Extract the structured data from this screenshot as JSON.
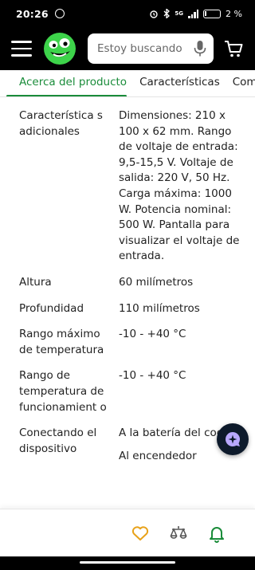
{
  "status_bar": {
    "time": "20:26",
    "network": "5G",
    "battery": "2 %"
  },
  "header": {
    "search": {
      "placeholder": "Estoy buscando"
    },
    "icons": [
      "menu-icon",
      "logo-icon",
      "mic-icon",
      "cart-icon"
    ],
    "brand_color": "#3dd34a"
  },
  "tabs": [
    {
      "label": "Acerca del producto",
      "active": true
    },
    {
      "label": "Características",
      "active": false
    },
    {
      "label": "Com",
      "active": false
    }
  ],
  "specs": [
    {
      "label": "Característica s adicionales",
      "value": "Dimensiones: 210 x 100 x 62 mm. Rango de voltaje de entrada: 9,5-15,5 V. Voltaje de salida: 220 V, 50 Hz. Carga máxima: 1000 W. Potencia nominal: 500 W. Pantalla para visualizar el voltaje de entrada."
    },
    {
      "label": "Altura",
      "value": "60 milímetros"
    },
    {
      "label": "Profundidad",
      "value": "110 milímetros"
    },
    {
      "label": "Rango máximo de temperatura",
      "value": "-10 - +40 °C"
    },
    {
      "label": "Rango de temperatura de funcionamient o",
      "value": "-10 - +40 °C"
    },
    {
      "label": "Conectando el dispositivo",
      "value": "A la batería del coche"
    },
    {
      "label": "",
      "value": "Al encendedor"
    }
  ],
  "colors": {
    "accent": "#1a8c3a",
    "fab": "#0d1a2b",
    "favorite": "#e8a21a",
    "notification": "#1a8c3a"
  },
  "bottom_bar": {
    "icons": [
      "heart-icon",
      "compare-icon",
      "bell-icon"
    ]
  }
}
